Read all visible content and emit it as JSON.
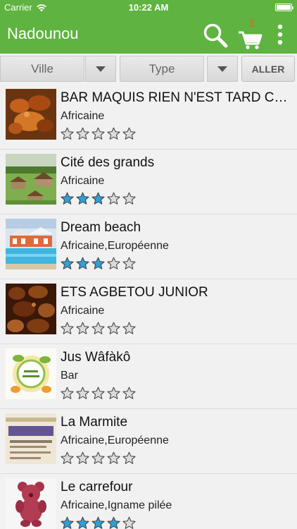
{
  "status": {
    "carrier": "Carrier",
    "time": "10:22 AM"
  },
  "header": {
    "title": "Nadounou",
    "cart_count": "3"
  },
  "filters": {
    "ville_label": "Ville",
    "type_label": "Type",
    "go_label": "ALLER"
  },
  "colors": {
    "brand": "#5fb340",
    "star_filled": "#2f9fd8",
    "star_empty": "#dcdcdc",
    "cart_badge": "#e8621e"
  },
  "restaurants": [
    {
      "name": "BAR MAQUIS RIEN N'EST TARD CHEZ",
      "type": "Africaine",
      "rating": 0,
      "thumb": "grilled-chicken-dish"
    },
    {
      "name": "Cité des grands",
      "type": "Africaine",
      "rating": 3,
      "thumb": "garden-huts"
    },
    {
      "name": "Dream beach",
      "type": "Africaine,Européenne",
      "rating": 3,
      "thumb": "beach-pool"
    },
    {
      "name": "ETS AGBETOU JUNIOR",
      "type": "Africaine",
      "rating": 0,
      "thumb": "roasted-meat"
    },
    {
      "name": "Jus Wâfàkô",
      "type": "Bar",
      "rating": 0,
      "thumb": "juice-logo"
    },
    {
      "name": "La Marmite",
      "type": "Africaine,Européenne",
      "rating": 0,
      "thumb": "marmite-sign"
    },
    {
      "name": "Le carrefour",
      "type": "Africaine,Igname pilée",
      "rating": 4,
      "thumb": "teddy-bear"
    }
  ]
}
